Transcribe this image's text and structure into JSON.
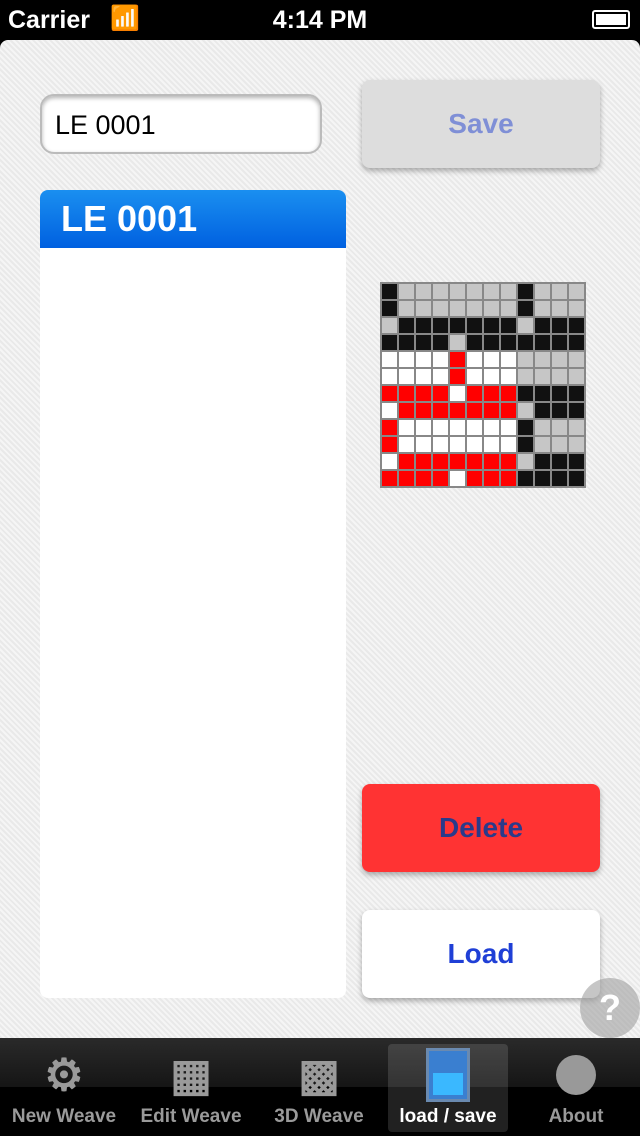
{
  "status": {
    "carrier": "Carrier",
    "time": "4:14 PM"
  },
  "name_field": {
    "value": "LE 0001"
  },
  "save_label": "Save",
  "list": {
    "items": [
      {
        "label": "LE 0001",
        "selected": true
      }
    ]
  },
  "weave_preview": {
    "colors": {
      "K": "#111111",
      "G": "#c6c6c6",
      "W": "#ffffff",
      "R": "#ff0000"
    },
    "rows": [
      "KGGGGGGGKGGG",
      "KGGGGGGGKGGG",
      "GKKKKKKKGKKK",
      "KKKKGKKKKKKK",
      "WWWWRWWWGGGG",
      "WWWWRWWWGGGG",
      "RRRRWRRRKKKK",
      "WRRRRRRRGKKK",
      "RWWWWWWWKGGG",
      "RWWWWWWWKGGG",
      "WRRRRRRRGKKK",
      "RRRRWRRRKKKK"
    ]
  },
  "delete_label": "Delete",
  "load_label": "Load",
  "help_label": "?",
  "tabs": [
    {
      "label": "New Weave",
      "icon": "gear-icon"
    },
    {
      "label": "Edit Weave",
      "icon": "grid-icon"
    },
    {
      "label": "3D Weave",
      "icon": "fabric-icon"
    },
    {
      "label": "load / save",
      "icon": "floppy-disk-icon",
      "active": true
    },
    {
      "label": "About",
      "icon": "circle-icon"
    }
  ]
}
